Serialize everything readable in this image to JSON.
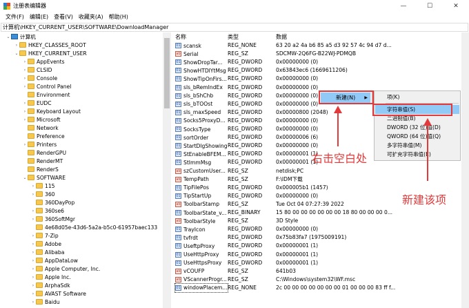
{
  "window": {
    "title": "注册表编辑器",
    "minimize": "—",
    "maximize": "☐",
    "close": "✕"
  },
  "menu": [
    "文件(F)",
    "编辑(E)",
    "查看(V)",
    "收藏夹(A)",
    "帮助(H)"
  ],
  "address": "计算机\\HKEY_CURRENT_USER\\SOFTWARE\\DownloadManager",
  "tree": [
    {
      "label": "计算机",
      "exp": "⌄"
    },
    {
      "label": "HKEY_CLASSES_ROOT",
      "exp": "›"
    },
    {
      "label": "HKEY_CURRENT_USER",
      "exp": "⌄"
    },
    {
      "label": "AppEvents",
      "exp": "›"
    },
    {
      "label": "CLSID",
      "exp": "›"
    },
    {
      "label": "Console",
      "exp": "›"
    },
    {
      "label": "Control Panel",
      "exp": "›"
    },
    {
      "label": "Environment",
      "exp": ""
    },
    {
      "label": "EUDC",
      "exp": "›"
    },
    {
      "label": "Keyboard Layout",
      "exp": "›"
    },
    {
      "label": "Microsoft",
      "exp": "›"
    },
    {
      "label": "Network",
      "exp": ""
    },
    {
      "label": "Preference",
      "exp": ""
    },
    {
      "label": "Printers",
      "exp": "›"
    },
    {
      "label": "RenderGPU",
      "exp": ""
    },
    {
      "label": "RenderMT",
      "exp": ""
    },
    {
      "label": "RenderS",
      "exp": ""
    },
    {
      "label": "SOFTWARE",
      "exp": "⌄"
    },
    {
      "label": "115",
      "exp": "›"
    },
    {
      "label": "360",
      "exp": "›"
    },
    {
      "label": "360DayPop",
      "exp": ""
    },
    {
      "label": "360se6",
      "exp": "›"
    },
    {
      "label": "360SoftMgr",
      "exp": "›"
    },
    {
      "label": "4e68d05e-43d6-5a2a-b5c0-61957baec133",
      "exp": ""
    },
    {
      "label": "7-Zip",
      "exp": "›"
    },
    {
      "label": "Adobe",
      "exp": "›"
    },
    {
      "label": "Alibaba",
      "exp": "›"
    },
    {
      "label": "AppDataLow",
      "exp": "›"
    },
    {
      "label": "Apple Computer, Inc.",
      "exp": "›"
    },
    {
      "label": "Apple Inc.",
      "exp": "›"
    },
    {
      "label": "ArphaSdk",
      "exp": "›"
    },
    {
      "label": "AVAST Software",
      "exp": "›"
    },
    {
      "label": "Baidu",
      "exp": "›"
    }
  ],
  "list_header": {
    "name": "名称",
    "type": "类型",
    "data": "数据"
  },
  "values": [
    {
      "name": "scansk",
      "type": "REG_NONE",
      "data": "63 20 a2 4a b6 85 a5 d3 92 57 4c 94 d7 d...",
      "icon": "01"
    },
    {
      "name": "Serial",
      "type": "REG_SZ",
      "data": "SDCMW-2Q6FG-B22WJ-PDMQB",
      "icon": "ab"
    },
    {
      "name": "ShowDropTar...",
      "type": "REG_DWORD",
      "data": "0x00000000 (0)",
      "icon": "01"
    },
    {
      "name": "ShowHTDlYtMsg",
      "type": "REG_DWORD",
      "data": "0x63843ec6 (1669611206)",
      "icon": "01"
    },
    {
      "name": "ShowTipOnFirs...",
      "type": "REG_DWORD",
      "data": "0x00000000 (0)",
      "icon": "01"
    },
    {
      "name": "sls_bRemIndEx",
      "type": "REG_DWORD",
      "data": "0x00000000 (0)",
      "icon": "01"
    },
    {
      "name": "sls_bShChb",
      "type": "REG_DWORD",
      "data": "0x00000000 (0)",
      "icon": "01"
    },
    {
      "name": "sls_bTOOst",
      "type": "REG_DWORD",
      "data": "0x00000000 (0)",
      "icon": "01"
    },
    {
      "name": "sls_maxSpeed",
      "type": "REG_DWORD",
      "data": "0x00000800 (2048)",
      "icon": "01"
    },
    {
      "name": "Socks5ProxyD...",
      "type": "REG_DWORD",
      "data": "0x00000000 (0)",
      "icon": "01"
    },
    {
      "name": "SocksType",
      "type": "REG_DWORD",
      "data": "0x00000000 (0)",
      "icon": "01"
    },
    {
      "name": "sortOrder",
      "type": "REG_DWORD",
      "data": "0x00000006 (6)",
      "icon": "01"
    },
    {
      "name": "StartDlgShowing",
      "type": "REG_DWORD",
      "data": "0x00000000 (0)",
      "icon": "01"
    },
    {
      "name": "StEnableBFEM...",
      "type": "REG_DWORD",
      "data": "0x00000001 (1)",
      "icon": "01"
    },
    {
      "name": "StImmMsg",
      "type": "REG_DWORD",
      "data": "0x00000001 (1)",
      "icon": "01"
    },
    {
      "name": "szCustomUser...",
      "type": "REG_SZ",
      "data": "netdisk;PC",
      "icon": "ab"
    },
    {
      "name": "TempPath",
      "type": "REG_SZ",
      "data": "F:\\IDM下载",
      "icon": "ab"
    },
    {
      "name": "TipFilePos",
      "type": "REG_DWORD",
      "data": "0x000005b1 (1457)",
      "icon": "01"
    },
    {
      "name": "TipStartUp",
      "type": "REG_DWORD",
      "data": "0x00000000 (0)",
      "icon": "01"
    },
    {
      "name": "ToolbarStamp",
      "type": "REG_SZ",
      "data": "Tue Oct 04 07:27:39 2022",
      "icon": "ab"
    },
    {
      "name": "ToolbarState_v...",
      "type": "REG_BINARY",
      "data": "15 80 00 00 00 00 00 00 18 80 00 00 00 0...",
      "icon": "01"
    },
    {
      "name": "ToolbarStyle",
      "type": "REG_SZ",
      "data": "3D Style",
      "icon": "ab"
    },
    {
      "name": "TrayIcon",
      "type": "REG_DWORD",
      "data": "0x00000000 (0)",
      "icon": "01"
    },
    {
      "name": "tvfrdt",
      "type": "REG_DWORD",
      "data": "0x75b83fa7 (1975009191)",
      "icon": "01"
    },
    {
      "name": "UseftpProxy",
      "type": "REG_DWORD",
      "data": "0x00000001 (1)",
      "icon": "01"
    },
    {
      "name": "UseHttpProxy",
      "type": "REG_DWORD",
      "data": "0x00000001 (1)",
      "icon": "01"
    },
    {
      "name": "UseHttpsProxy",
      "type": "REG_DWORD",
      "data": "0x00000001 (1)",
      "icon": "01"
    },
    {
      "name": "vCOUFP",
      "type": "REG_SZ",
      "data": "641b03",
      "icon": "ab"
    },
    {
      "name": "VScannerProgr...",
      "type": "REG_SZ",
      "data": "C:\\Windows\\system32\\WF.msc",
      "icon": "ab"
    },
    {
      "name": "windowPlacem...",
      "type": "REG_NONE",
      "data": "2c 00 00 00 00 00 00 00 01 00 00 00 83 ff f...",
      "icon": "01"
    }
  ],
  "context_menu": {
    "new_item": "新建(N)",
    "submenu": [
      "项(K)",
      "字符串值(S)",
      "二进制值(B)",
      "DWORD (32 位)值(D)",
      "QWORD (64 位)值(Q)",
      "多字符串值(M)",
      "可扩充字符串值(E)"
    ]
  },
  "annotations": {
    "right_click": "右击空白处",
    "new_item": "新建该项"
  },
  "colors": {
    "highlight": "#e23a3a",
    "menu_selected": "#91c9f7"
  }
}
